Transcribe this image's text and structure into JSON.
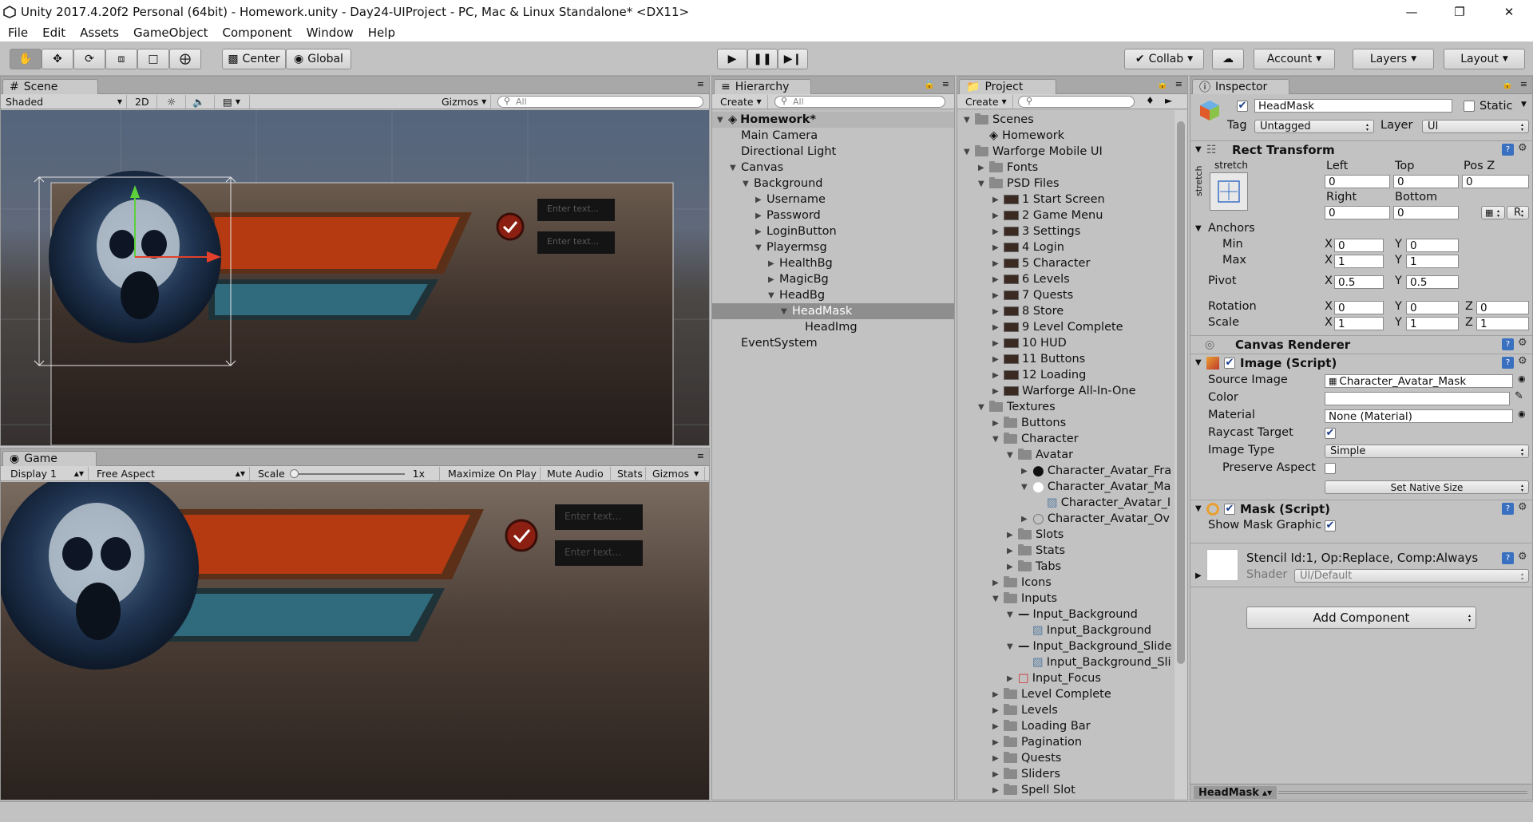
{
  "window": {
    "title": "Unity 2017.4.20f2 Personal (64bit) - Homework.unity - Day24-UIProject - PC, Mac & Linux Standalone* <DX11>"
  },
  "menu": [
    "File",
    "Edit",
    "Assets",
    "GameObject",
    "Component",
    "Window",
    "Help"
  ],
  "toolbar": {
    "center": "Center",
    "global": "Global",
    "collab": "Collab",
    "account": "Account",
    "layers": "Layers",
    "layout": "Layout"
  },
  "scene": {
    "tab": "Scene",
    "shading": "Shaded",
    "mode2d": "2D",
    "gizmos": "Gizmos",
    "search": "All",
    "placeholder": "Enter text..."
  },
  "game": {
    "tab": "Game",
    "display": "Display 1",
    "aspect": "Free Aspect",
    "scale_label": "Scale",
    "scale_value": "1x",
    "maximize": "Maximize On Play",
    "mute": "Mute Audio",
    "stats": "Stats",
    "gizmos": "Gizmos",
    "placeholder": "Enter text..."
  },
  "hierarchy": {
    "tab": "Hierarchy",
    "create": "Create",
    "search": "All",
    "items": [
      {
        "label": "Homework*",
        "depth": 0,
        "arrow": "open",
        "bold": true,
        "icon": "unity-scene-icon"
      },
      {
        "label": "Main Camera",
        "depth": 1,
        "arrow": ""
      },
      {
        "label": "Directional Light",
        "depth": 1,
        "arrow": ""
      },
      {
        "label": "Canvas",
        "depth": 1,
        "arrow": "open"
      },
      {
        "label": "Background",
        "depth": 2,
        "arrow": "open"
      },
      {
        "label": "Username",
        "depth": 3,
        "arrow": "closed"
      },
      {
        "label": "Password",
        "depth": 3,
        "arrow": "closed"
      },
      {
        "label": "LoginButton",
        "depth": 3,
        "arrow": "closed"
      },
      {
        "label": "Playermsg",
        "depth": 3,
        "arrow": "open"
      },
      {
        "label": "HealthBg",
        "depth": 4,
        "arrow": "closed"
      },
      {
        "label": "MagicBg",
        "depth": 4,
        "arrow": "closed"
      },
      {
        "label": "HeadBg",
        "depth": 4,
        "arrow": "open"
      },
      {
        "label": "HeadMask",
        "depth": 5,
        "arrow": "open",
        "selected": true
      },
      {
        "label": "HeadImg",
        "depth": 6,
        "arrow": ""
      },
      {
        "label": "EventSystem",
        "depth": 1,
        "arrow": ""
      }
    ]
  },
  "project": {
    "tab": "Project",
    "create": "Create",
    "items": [
      {
        "label": "Scenes",
        "depth": 0,
        "arrow": "open",
        "icon": "folder"
      },
      {
        "label": "Homework",
        "depth": 1,
        "arrow": "",
        "icon": "scene"
      },
      {
        "label": "Warforge Mobile UI",
        "depth": 0,
        "arrow": "open",
        "icon": "folder"
      },
      {
        "label": "Fonts",
        "depth": 1,
        "arrow": "closed",
        "icon": "folder"
      },
      {
        "label": "PSD Files",
        "depth": 1,
        "arrow": "open",
        "icon": "folder"
      },
      {
        "label": "1 Start Screen",
        "depth": 2,
        "arrow": "closed",
        "icon": "psd"
      },
      {
        "label": "2 Game Menu",
        "depth": 2,
        "arrow": "closed",
        "icon": "psd"
      },
      {
        "label": "3 Settings",
        "depth": 2,
        "arrow": "closed",
        "icon": "psd"
      },
      {
        "label": "4 Login",
        "depth": 2,
        "arrow": "closed",
        "icon": "psd"
      },
      {
        "label": "5 Character",
        "depth": 2,
        "arrow": "closed",
        "icon": "psd"
      },
      {
        "label": "6 Levels",
        "depth": 2,
        "arrow": "closed",
        "icon": "psd"
      },
      {
        "label": "7 Quests",
        "depth": 2,
        "arrow": "closed",
        "icon": "psd"
      },
      {
        "label": "8 Store",
        "depth": 2,
        "arrow": "closed",
        "icon": "psd"
      },
      {
        "label": "9 Level Complete",
        "depth": 2,
        "arrow": "closed",
        "icon": "psd"
      },
      {
        "label": "10 HUD",
        "depth": 2,
        "arrow": "closed",
        "icon": "psd"
      },
      {
        "label": "11 Buttons",
        "depth": 2,
        "arrow": "closed",
        "icon": "psd"
      },
      {
        "label": "12 Loading",
        "depth": 2,
        "arrow": "closed",
        "icon": "psd"
      },
      {
        "label": "Warforge All-In-One",
        "depth": 2,
        "arrow": "closed",
        "icon": "psd"
      },
      {
        "label": "Textures",
        "depth": 1,
        "arrow": "open",
        "icon": "folder"
      },
      {
        "label": "Buttons",
        "depth": 2,
        "arrow": "closed",
        "icon": "folder"
      },
      {
        "label": "Character",
        "depth": 2,
        "arrow": "open",
        "icon": "folder"
      },
      {
        "label": "Avatar",
        "depth": 3,
        "arrow": "open",
        "icon": "folder"
      },
      {
        "label": "Character_Avatar_Fra",
        "depth": 4,
        "arrow": "closed",
        "icon": "black-circle"
      },
      {
        "label": "Character_Avatar_Ma",
        "depth": 4,
        "arrow": "open",
        "icon": "white-circle"
      },
      {
        "label": "Character_Avatar_I",
        "depth": 5,
        "arrow": "",
        "icon": "sprite"
      },
      {
        "label": "Character_Avatar_Ov",
        "depth": 4,
        "arrow": "closed",
        "icon": "ring"
      },
      {
        "label": "Slots",
        "depth": 3,
        "arrow": "closed",
        "icon": "folder"
      },
      {
        "label": "Stats",
        "depth": 3,
        "arrow": "closed",
        "icon": "folder"
      },
      {
        "label": "Tabs",
        "depth": 3,
        "arrow": "closed",
        "icon": "folder"
      },
      {
        "label": "Icons",
        "depth": 2,
        "arrow": "closed",
        "icon": "folder"
      },
      {
        "label": "Inputs",
        "depth": 2,
        "arrow": "open",
        "icon": "folder"
      },
      {
        "label": "Input_Background",
        "depth": 3,
        "arrow": "open",
        "icon": "dash"
      },
      {
        "label": "Input_Background",
        "depth": 4,
        "arrow": "",
        "icon": "sprite"
      },
      {
        "label": "Input_Background_Slide",
        "depth": 3,
        "arrow": "open",
        "icon": "dash"
      },
      {
        "label": "Input_Background_Sli",
        "depth": 4,
        "arrow": "",
        "icon": "sprite"
      },
      {
        "label": "Input_Focus",
        "depth": 3,
        "arrow": "closed",
        "icon": "redbox"
      },
      {
        "label": "Level Complete",
        "depth": 2,
        "arrow": "closed",
        "icon": "folder"
      },
      {
        "label": "Levels",
        "depth": 2,
        "arrow": "closed",
        "icon": "folder"
      },
      {
        "label": "Loading Bar",
        "depth": 2,
        "arrow": "closed",
        "icon": "folder"
      },
      {
        "label": "Pagination",
        "depth": 2,
        "arrow": "closed",
        "icon": "folder"
      },
      {
        "label": "Quests",
        "depth": 2,
        "arrow": "closed",
        "icon": "folder"
      },
      {
        "label": "Sliders",
        "depth": 2,
        "arrow": "closed",
        "icon": "folder"
      },
      {
        "label": "Spell Slot",
        "depth": 2,
        "arrow": "closed",
        "icon": "folder"
      }
    ]
  },
  "inspector": {
    "tab": "Inspector",
    "name": "HeadMask",
    "static_label": "Static",
    "tag_label": "Tag",
    "tag_value": "Untagged",
    "layer_label": "Layer",
    "layer_value": "UI",
    "rect": {
      "title": "Rect Transform",
      "stretch": "stretch",
      "left_l": "Left",
      "top_l": "Top",
      "posz_l": "Pos Z",
      "left": "0",
      "top": "0",
      "posz": "0",
      "right_l": "Right",
      "bottom_l": "Bottom",
      "right": "0",
      "bottom": "0",
      "r_btn": "R",
      "anchors": "Anchors",
      "min": "Min",
      "max": "Max",
      "pivot": "Pivot",
      "rotation": "Rotation",
      "scale": "Scale",
      "x": "X",
      "y": "Y",
      "z": "Z",
      "min_x": "0",
      "min_y": "0",
      "max_x": "1",
      "max_y": "1",
      "pivot_x": "0.5",
      "pivot_y": "0.5",
      "rot_x": "0",
      "rot_y": "0",
      "rot_z": "0",
      "sc_x": "1",
      "sc_y": "1",
      "sc_z": "1"
    },
    "canvas_renderer": "Canvas Renderer",
    "image": {
      "title": "Image (Script)",
      "source_l": "Source Image",
      "source": "Character_Avatar_Mask",
      "color_l": "Color",
      "material_l": "Material",
      "material": "None (Material)",
      "raycast_l": "Raycast Target",
      "type_l": "Image Type",
      "type": "Simple",
      "preserve_l": "Preserve Aspect",
      "native": "Set Native Size"
    },
    "mask": {
      "title": "Mask (Script)",
      "show_l": "Show Mask Graphic"
    },
    "material": {
      "stencil": "Stencil Id:1, Op:Replace, Comp:Always",
      "shader_l": "Shader",
      "shader": "UI/Default"
    },
    "add_component": "Add Component",
    "footer": "HeadMask"
  }
}
